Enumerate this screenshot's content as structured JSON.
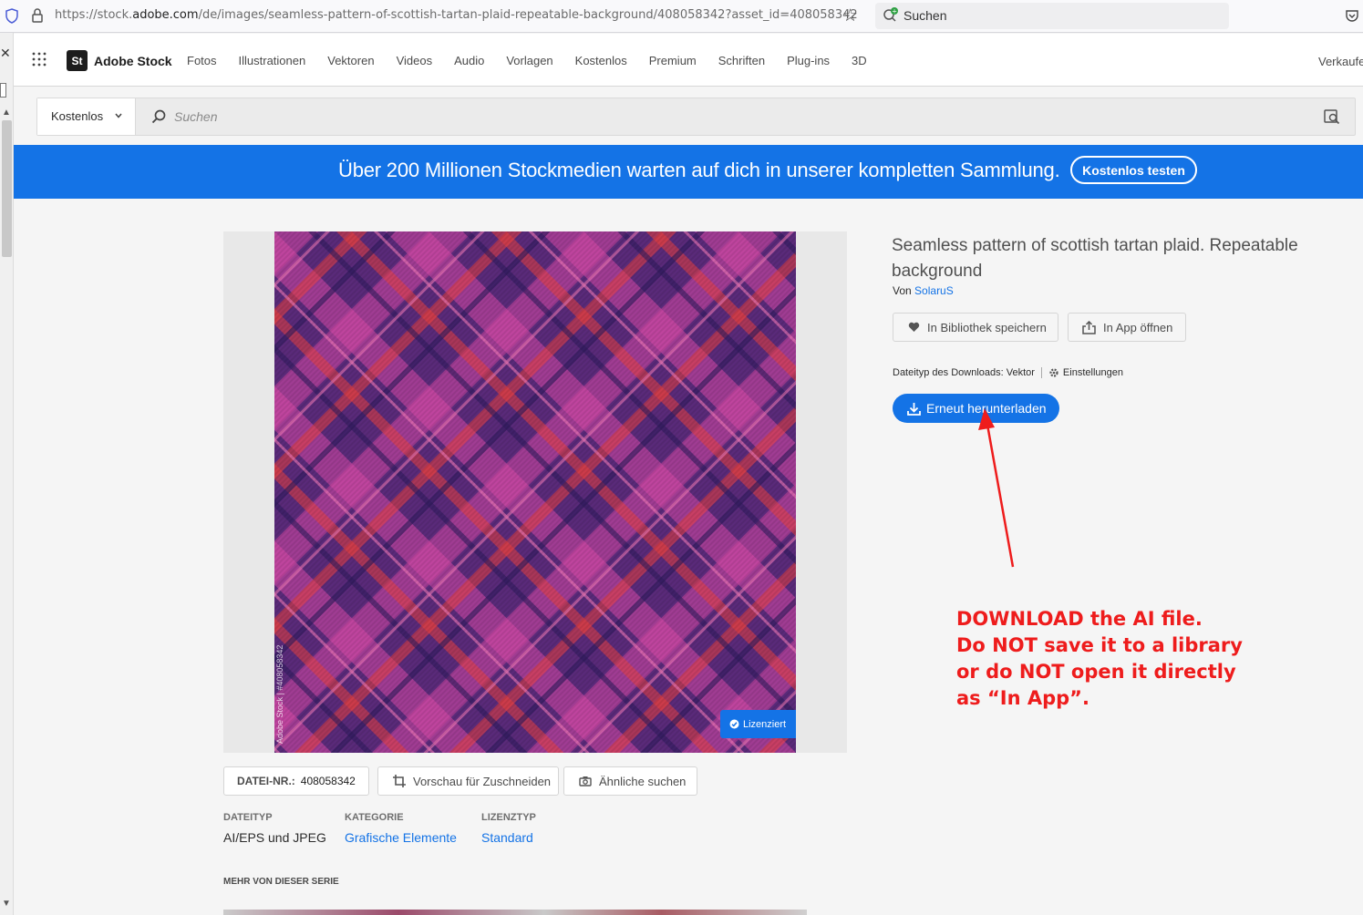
{
  "browser": {
    "url_prefix": "https://stock.",
    "url_domain": "adobe.com",
    "url_rest": "/de/images/seamless-pattern-of-scottish-tartan-plaid-repeatable-background/408058342?asset_id=408058342",
    "search_label": "Suchen"
  },
  "nav": {
    "logo_badge": "St",
    "logo_text": "Adobe Stock",
    "links": [
      "Fotos",
      "Illustrationen",
      "Vektoren",
      "Videos",
      "Audio",
      "Vorlagen",
      "Kostenlos",
      "Premium",
      "Schriften",
      "Plug-ins",
      "3D"
    ],
    "sell": "Verkaufe"
  },
  "search": {
    "category": "Kostenlos",
    "placeholder": "Suchen"
  },
  "banner": {
    "text": "Über 200 Millionen Stockmedien warten auf dich in unserer kompletten Sammlung.",
    "button": "Kostenlos testen"
  },
  "asset": {
    "watermark": "Adobe Stock | #408058342",
    "licensed": "Lizenziert",
    "title": "Seamless pattern of scottish tartan plaid. Repeatable background",
    "by_label": "Von",
    "author": "SolaruS",
    "file_nr_label": "DATEI-NR.:",
    "file_nr": "408058342",
    "crop_preview": "Vorschau für Zuschneiden",
    "find_similar": "Ähnliche suchen",
    "save_library": "In Bibliothek speichern",
    "open_in_app": "In App öffnen",
    "download_filetype": "Dateityp des Downloads: Vektor",
    "settings": "Einstellungen",
    "download_again": "Erneut herunterladen",
    "meta": {
      "filetype_label": "DATEITYP",
      "filetype": "AI/EPS und JPEG",
      "category_label": "KATEGORIE",
      "category": "Grafische Elemente",
      "license_label": "LIZENZTYP",
      "license": "Standard"
    },
    "more_series": "MEHR VON DIESER SERIE"
  },
  "annotation": {
    "line1": "DOWNLOAD the AI file.",
    "line2": "Do NOT save it to a library",
    "line3": "or do NOT open it directly",
    "line4": "as “In App”."
  },
  "colors": {
    "accent": "#1473e6",
    "annotation": "#ee1c1c",
    "tartan_base": "#5a2a7a",
    "tartan_pink": "#d94aa8",
    "tartan_red": "#e8403e"
  }
}
